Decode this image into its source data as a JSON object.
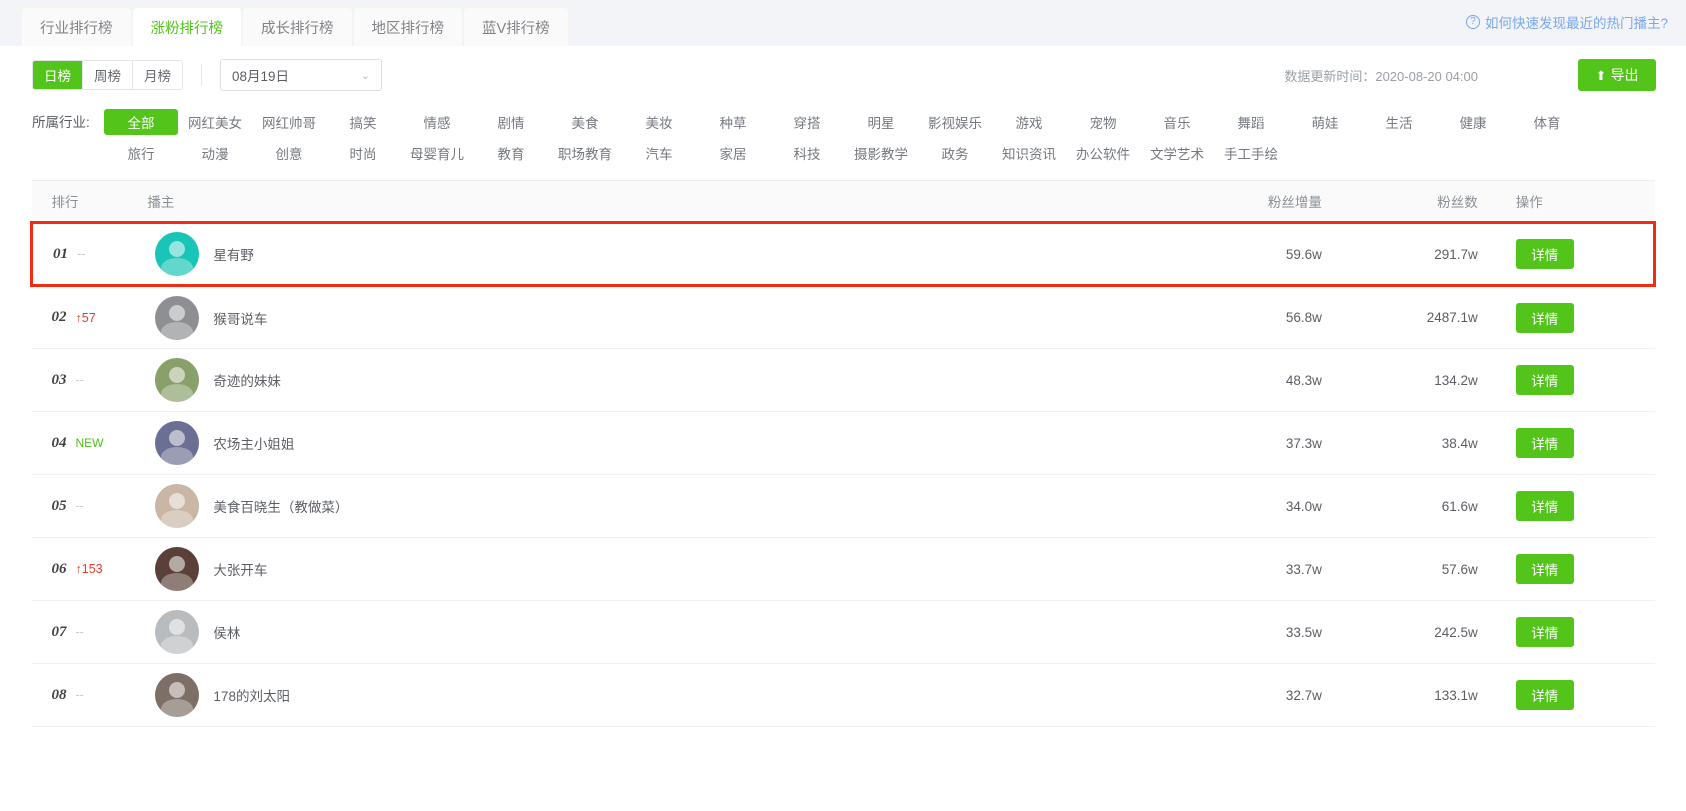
{
  "tabs": [
    {
      "label": "行业排行榜",
      "active": false
    },
    {
      "label": "涨粉排行榜",
      "active": true
    },
    {
      "label": "成长排行榜",
      "active": false
    },
    {
      "label": "地区排行榜",
      "active": false
    },
    {
      "label": "蓝V排行榜",
      "active": false
    }
  ],
  "help": {
    "icon": "question-mark-circle-icon",
    "label": "如何快速发现最近的热门播主?"
  },
  "toolbar": {
    "periods": [
      {
        "label": "日榜",
        "active": true
      },
      {
        "label": "周榜",
        "active": false
      },
      {
        "label": "月榜",
        "active": false
      }
    ],
    "date_value": "08月19日",
    "caret": "⌄",
    "update_time": "数据更新时间：2020-08-20 04:00",
    "export_label": "导出",
    "export_icon": "upload-icon",
    "export_glyph": "⬆"
  },
  "filters": {
    "label": "所属行业:",
    "items": [
      {
        "label": "全部",
        "active": true
      },
      {
        "label": "网红美女",
        "active": false
      },
      {
        "label": "网红帅哥",
        "active": false
      },
      {
        "label": "搞笑",
        "active": false
      },
      {
        "label": "情感",
        "active": false
      },
      {
        "label": "剧情",
        "active": false
      },
      {
        "label": "美食",
        "active": false
      },
      {
        "label": "美妆",
        "active": false
      },
      {
        "label": "种草",
        "active": false
      },
      {
        "label": "穿搭",
        "active": false
      },
      {
        "label": "明星",
        "active": false
      },
      {
        "label": "影视娱乐",
        "active": false
      },
      {
        "label": "游戏",
        "active": false
      },
      {
        "label": "宠物",
        "active": false
      },
      {
        "label": "音乐",
        "active": false
      },
      {
        "label": "舞蹈",
        "active": false
      },
      {
        "label": "萌娃",
        "active": false
      },
      {
        "label": "生活",
        "active": false
      },
      {
        "label": "健康",
        "active": false
      },
      {
        "label": "体育",
        "active": false
      },
      {
        "label": "旅行",
        "active": false
      },
      {
        "label": "动漫",
        "active": false
      },
      {
        "label": "创意",
        "active": false
      },
      {
        "label": "时尚",
        "active": false
      },
      {
        "label": "母婴育儿",
        "active": false
      },
      {
        "label": "教育",
        "active": false
      },
      {
        "label": "职场教育",
        "active": false
      },
      {
        "label": "汽车",
        "active": false
      },
      {
        "label": "家居",
        "active": false
      },
      {
        "label": "科技",
        "active": false
      },
      {
        "label": "摄影教学",
        "active": false
      },
      {
        "label": "政务",
        "active": false
      },
      {
        "label": "知识资讯",
        "active": false
      },
      {
        "label": "办公软件",
        "active": false
      },
      {
        "label": "文学艺术",
        "active": false
      },
      {
        "label": "手工手绘",
        "active": false
      }
    ]
  },
  "table": {
    "columns": [
      "排行",
      "播主",
      "粉丝增量",
      "粉丝数",
      "操作"
    ],
    "action_label": "详情",
    "rows": [
      {
        "rank": "01",
        "delta": "--",
        "delta_type": "none",
        "name": "星有野",
        "increment": "59.6w",
        "fans": "291.7w",
        "highlight": true,
        "avatar": "#18c5b6"
      },
      {
        "rank": "02",
        "delta": "↑57",
        "delta_type": "up",
        "name": "猴哥说车",
        "increment": "56.8w",
        "fans": "2487.1w",
        "highlight": false,
        "avatar": "#8d8f92"
      },
      {
        "rank": "03",
        "delta": "--",
        "delta_type": "none",
        "name": "奇迹的妹妹",
        "increment": "48.3w",
        "fans": "134.2w",
        "highlight": false,
        "avatar": "#8aa06a"
      },
      {
        "rank": "04",
        "delta": "NEW",
        "delta_type": "new",
        "name": "农场主小姐姐",
        "increment": "37.3w",
        "fans": "38.4w",
        "highlight": false,
        "avatar": "#6b6f93"
      },
      {
        "rank": "05",
        "delta": "--",
        "delta_type": "none",
        "name": "美食百晓生（教做菜）",
        "increment": "34.0w",
        "fans": "61.6w",
        "highlight": false,
        "avatar": "#c9b6a4"
      },
      {
        "rank": "06",
        "delta": "↑153",
        "delta_type": "up",
        "name": "大张开车",
        "increment": "33.7w",
        "fans": "57.6w",
        "highlight": false,
        "avatar": "#5a4038"
      },
      {
        "rank": "07",
        "delta": "--",
        "delta_type": "none",
        "name": "侯林",
        "increment": "33.5w",
        "fans": "242.5w",
        "highlight": false,
        "avatar": "#b9bcbf"
      },
      {
        "rank": "08",
        "delta": "--",
        "delta_type": "none",
        "name": "178的刘太阳",
        "increment": "32.7w",
        "fans": "133.1w",
        "highlight": false,
        "avatar": "#7e6f66"
      }
    ]
  }
}
